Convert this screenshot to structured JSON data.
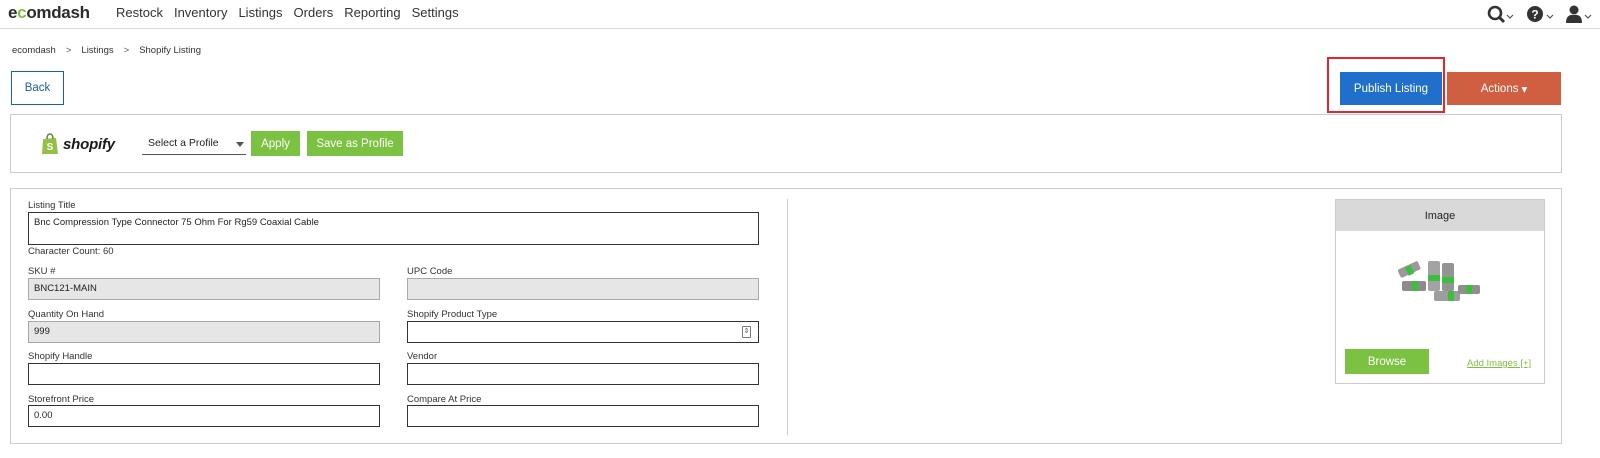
{
  "app": {
    "logo_text_pre": "e",
    "logo_text_c": "c",
    "logo_text_post": "omdash"
  },
  "nav": {
    "items": [
      "Restock",
      "Inventory",
      "Listings",
      "Orders",
      "Reporting",
      "Settings"
    ],
    "icons": [
      "search-icon",
      "help-icon",
      "user-icon"
    ]
  },
  "breadcrumb": {
    "items": [
      "ecomdash",
      "Listings",
      "Shopify Listing"
    ],
    "separator": ">"
  },
  "toolbar": {
    "back_label": "Back",
    "publish_label": "Publish Listing",
    "actions_label": "Actions",
    "actions_caret": "▾"
  },
  "shopify_bar": {
    "brand": "shopify",
    "profile_select_value": "Select a Profile",
    "apply_label": "Apply",
    "save_profile_label": "Save as Profile"
  },
  "form": {
    "listing_title_label": "Listing Title",
    "listing_title_value": "Bnc Compression Type Connector 75 Ohm For Rg59 Coaxial Cable",
    "character_count": "Character Count: 60",
    "sku_label": "SKU #",
    "sku_value": "BNC121-MAIN",
    "upc_label": "UPC Code",
    "upc_value": "",
    "qty_label": "Quantity On Hand",
    "qty_value": "999",
    "product_type_label": "Shopify Product Type",
    "product_type_value": "",
    "handle_label": "Shopify Handle",
    "handle_value": "",
    "vendor_label": "Vendor",
    "vendor_value": "",
    "price_label": "Storefront Price",
    "price_value": "0.00",
    "compare_label": "Compare At Price",
    "compare_value": ""
  },
  "image_panel": {
    "header": "Image",
    "browse_label": "Browse",
    "add_images_label": "Add Images [+]"
  },
  "colors": {
    "accent_green": "#7cc242",
    "publish_blue": "#1f6fcb",
    "actions_orange": "#d05f42",
    "highlight_red": "#e3262b"
  }
}
